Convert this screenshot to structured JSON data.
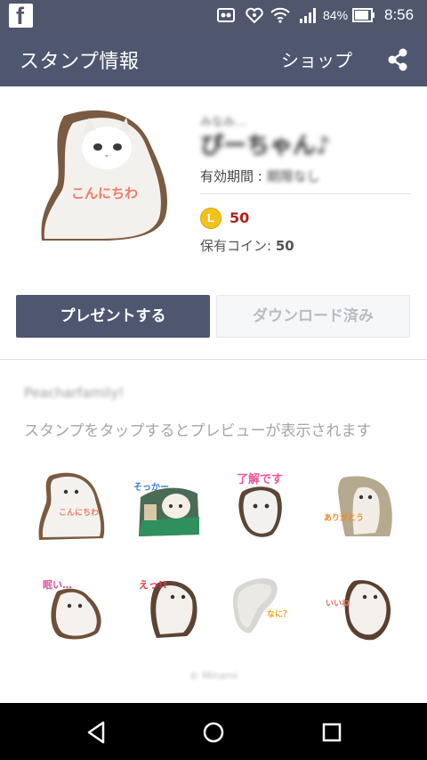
{
  "status_bar": {
    "battery_percent": "84%",
    "time": "8:56",
    "icons": [
      "facebook-icon",
      "notification-icon",
      "heart-notification-icon",
      "wifi-icon",
      "signal-icon",
      "battery-icon"
    ]
  },
  "app_bar": {
    "title": "スタンプ情報",
    "shop_label": "ショップ",
    "share_icon": "share-icon",
    "background": "#4f5670"
  },
  "sticker_pack": {
    "author": "みなみ…",
    "title": "ぴーちゃん♪",
    "validity_label": "有効期間 : ",
    "validity_value": "期限なし",
    "main_sticker_caption": "こんにちわ",
    "coin_symbol": "L",
    "price": "50",
    "owned_coins_label": "保有コイン: ",
    "owned_coins_value": "50"
  },
  "buttons": {
    "present": "プレゼントする",
    "downloaded": "ダウンロード済み"
  },
  "creator": "Peacharfamily!",
  "hint": "スタンプをタップするとプレビューが表示されます",
  "stickers": [
    {
      "caption": "こんにちわ",
      "caption_color": "#f07b63"
    },
    {
      "caption": "そっかー",
      "caption_color": "#3d7fd6"
    },
    {
      "caption": "了解です",
      "caption_color": "#f2539b"
    },
    {
      "caption": "ありがとう",
      "caption_color": "#f08a2c"
    },
    {
      "caption": "眠い…",
      "caption_color": "#e0509a"
    },
    {
      "caption": "えっ!!",
      "caption_color": "#e63a4a"
    },
    {
      "caption": "なに？",
      "caption_color": "#f0a020"
    },
    {
      "caption": "いいね",
      "caption_color": "#f07060"
    }
  ],
  "copyright": "© Minami",
  "colors": {
    "accent": "#4f5670",
    "price": "#b0201c",
    "coin": "#f1c21b"
  },
  "nav": {
    "back": "back-icon",
    "home": "home-icon",
    "recents": "recents-icon"
  }
}
